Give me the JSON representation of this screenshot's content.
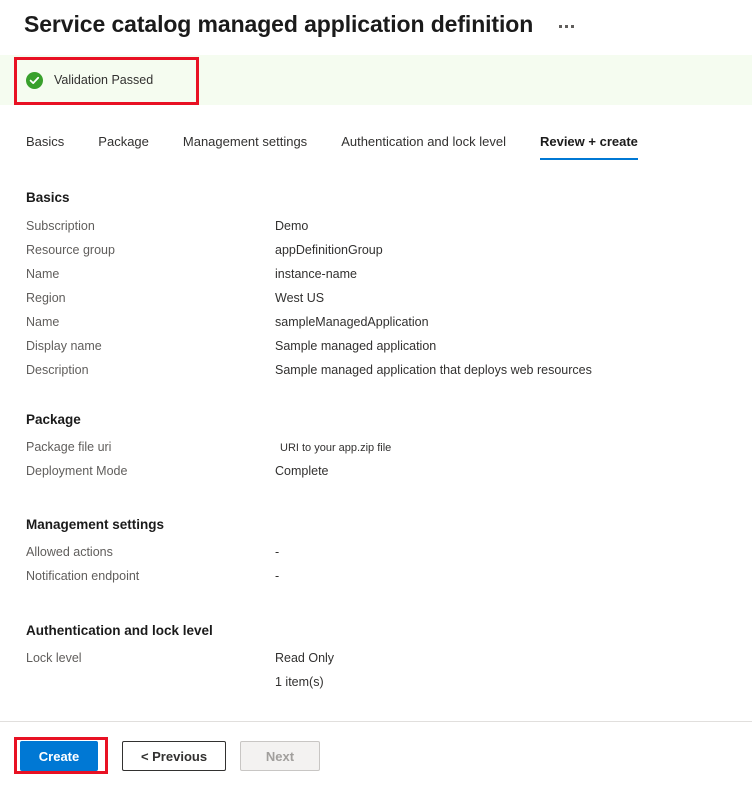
{
  "header": {
    "title": "Service catalog managed application definition",
    "more_menu_icon": "ellipsis-horizontal-icon"
  },
  "validation": {
    "icon": "check-circle-icon",
    "status_text": "Validation Passed",
    "banner_color": "#f5fcf0",
    "icon_color": "#38a02c",
    "annotation_color": "#e81123"
  },
  "tabs": [
    {
      "label": "Basics",
      "active": false
    },
    {
      "label": "Package",
      "active": false
    },
    {
      "label": "Management settings",
      "active": false
    },
    {
      "label": "Authentication and lock level",
      "active": false
    },
    {
      "label": "Review + create",
      "active": true
    }
  ],
  "sections": [
    {
      "heading": "Basics",
      "rows": [
        {
          "label": "Subscription",
          "value": "Demo"
        },
        {
          "label": "Resource group",
          "value": "appDefinitionGroup"
        },
        {
          "label": "Name",
          "value": "instance-name"
        },
        {
          "label": "Region",
          "value": "West US"
        },
        {
          "label": "Name",
          "value": "sampleManagedApplication"
        },
        {
          "label": "Display name",
          "value": "Sample managed application"
        },
        {
          "label": "Description",
          "value": "Sample managed application that deploys web resources"
        }
      ]
    },
    {
      "heading": "Package",
      "rows": [
        {
          "label": "Package file uri",
          "value": "URI to your app.zip file"
        },
        {
          "label": "Deployment Mode",
          "value": "Complete"
        }
      ]
    },
    {
      "heading": "Management settings",
      "rows": [
        {
          "label": "Allowed actions",
          "value": "-"
        },
        {
          "label": "Notification endpoint",
          "value": "-"
        }
      ]
    },
    {
      "heading": "Authentication and lock level",
      "rows": [
        {
          "label": "Lock level",
          "value": "Read Only"
        },
        {
          "label": "",
          "value": "1 item(s)"
        }
      ]
    }
  ],
  "footer": {
    "create_label": "Create",
    "previous_label": "< Previous",
    "next_label": "Next",
    "primary_color": "#0078d4",
    "annotation_color": "#e81123"
  }
}
